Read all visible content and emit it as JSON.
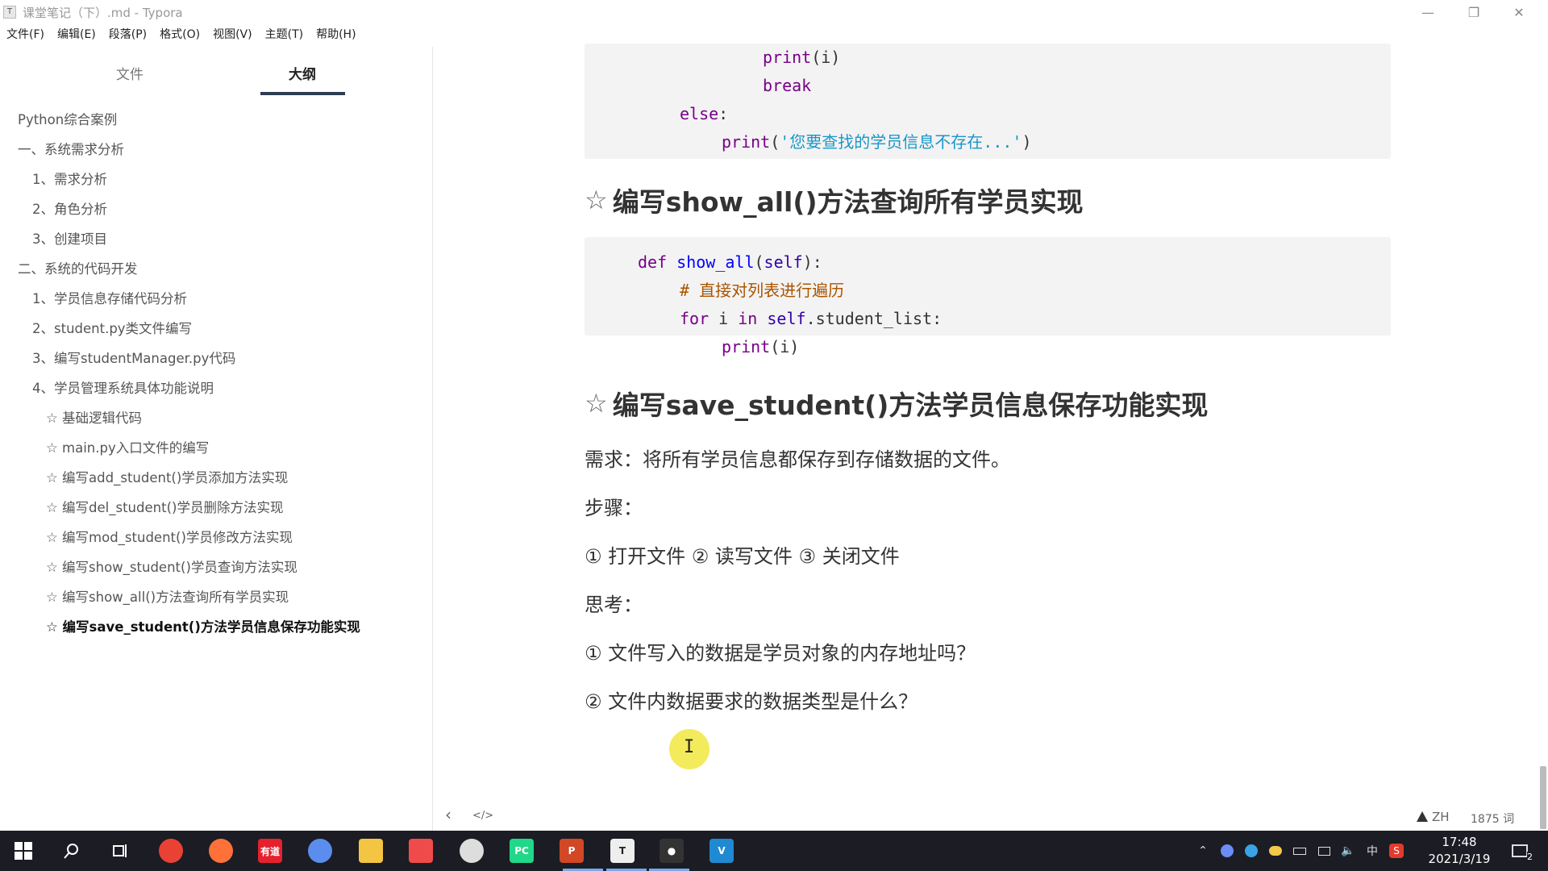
{
  "window": {
    "title": "课堂笔记（下）.md - Typora",
    "app_icon": "T"
  },
  "menu": [
    "文件(F)",
    "编辑(E)",
    "段落(P)",
    "格式(O)",
    "视图(V)",
    "主题(T)",
    "帮助(H)"
  ],
  "sidebar": {
    "tabs": [
      "文件",
      "大纲"
    ],
    "active_tab": "大纲",
    "outline": [
      {
        "text": "Python综合案例",
        "level": 1
      },
      {
        "text": "一、系统需求分析",
        "level": 1
      },
      {
        "text": "1、需求分析",
        "level": 2
      },
      {
        "text": "2、角色分析",
        "level": 2
      },
      {
        "text": "3、创建项目",
        "level": 2
      },
      {
        "text": "二、系统的代码开发",
        "level": 1
      },
      {
        "text": "1、学员信息存储代码分析",
        "level": 2
      },
      {
        "text": "2、student.py类文件编写",
        "level": 2
      },
      {
        "text": "3、编写studentManager.py代码",
        "level": 2
      },
      {
        "text": "4、学员管理系统具体功能说明",
        "level": 2
      },
      {
        "text": "☆ 基础逻辑代码",
        "level": 3
      },
      {
        "text": "☆ main.py入口文件的编写",
        "level": 3
      },
      {
        "text": "☆ 编写add_student()学员添加方法实现",
        "level": 3
      },
      {
        "text": "☆ 编写del_student()学员删除方法实现",
        "level": 3
      },
      {
        "text": "☆ 编写mod_student()学员修改方法实现",
        "level": 3
      },
      {
        "text": "☆ 编写show_student()学员查询方法实现",
        "level": 3
      },
      {
        "text": "☆ 编写show_all()方法查询所有学员实现",
        "level": 3
      },
      {
        "text": "☆ 编写save_student()方法学员信息保存功能实现",
        "level": 3,
        "active": true
      }
    ]
  },
  "editor": {
    "code_block_1": [
      [
        {
          "t": "print",
          "c": "kw"
        },
        {
          "t": "(i)",
          "c": "pl"
        }
      ],
      [
        {
          "t": "break",
          "c": "kw"
        }
      ],
      [
        {
          "t": "else",
          "c": "kw"
        },
        {
          "t": ":",
          "c": "pl"
        }
      ],
      [
        {
          "t": "print",
          "c": "kw"
        },
        {
          "t": "(",
          "c": "pl"
        },
        {
          "t": "'您要查找的学员信息不存在...'",
          "c": "str"
        },
        {
          "t": ")",
          "c": "pl"
        }
      ]
    ],
    "heading_1": {
      "star": "☆",
      "text": "编写show_all()方法查询所有学员实现"
    },
    "code_block_2": [
      [
        {
          "t": "def ",
          "c": "kw"
        },
        {
          "t": "show_all",
          "c": "fn"
        },
        {
          "t": "(",
          "c": "pl"
        },
        {
          "t": "self",
          "c": "self"
        },
        {
          "t": "):",
          "c": "pl"
        }
      ],
      [
        {
          "t": "# 直接对列表进行遍历",
          "c": "cm"
        }
      ],
      [
        {
          "t": "for ",
          "c": "kw"
        },
        {
          "t": "i ",
          "c": "pl"
        },
        {
          "t": "in ",
          "c": "kw"
        },
        {
          "t": "self",
          "c": "self"
        },
        {
          "t": ".student_list:",
          "c": "pl"
        }
      ],
      [
        {
          "t": "print",
          "c": "kw"
        },
        {
          "t": "(i)",
          "c": "pl"
        }
      ]
    ],
    "heading_2": {
      "star": "☆",
      "text": "编写save_student()方法学员信息保存功能实现"
    },
    "paragraphs": [
      "需求：将所有学员信息都保存到存储数据的文件。",
      "步骤：",
      "① 打开文件 ② 读写文件 ③ 关闭文件",
      "思考：",
      "① 文件写入的数据是学员对象的内存地址吗？",
      "② 文件内数据要求的数据类型是什么？"
    ]
  },
  "footer": {
    "back_icon": "‹",
    "source_icon": "</>",
    "lang": "ZH",
    "word_count": "1875 词"
  },
  "cursor": {
    "glyph": "I"
  },
  "taskbar": {
    "apps": [
      {
        "name": "chrome-icon",
        "color": "#e94235",
        "label": ""
      },
      {
        "name": "firefox-icon",
        "color": "#ff7139",
        "label": ""
      },
      {
        "name": "youdao-icon",
        "color": "#e5212d",
        "label": "有道"
      },
      {
        "name": "browser-icon",
        "color": "#5b8def",
        "label": ""
      },
      {
        "name": "file-explorer-icon",
        "color": "#f4c542",
        "label": ""
      },
      {
        "name": "video-app-icon",
        "color": "#f04b4b",
        "label": ""
      },
      {
        "name": "chrome-beta-icon",
        "color": "#dddddd",
        "label": ""
      },
      {
        "name": "pycharm-icon",
        "color": "#21d789",
        "label": "PC"
      },
      {
        "name": "powerpoint-icon",
        "color": "#d24726",
        "label": "P"
      },
      {
        "name": "typora-icon",
        "color": "#eeeeee",
        "label": "T"
      },
      {
        "name": "recorder-icon",
        "color": "#333333",
        "label": "●"
      },
      {
        "name": "vscode-icon",
        "color": "#1f8ad2",
        "label": "V"
      }
    ],
    "tray": {
      "ime": "中",
      "clock_time": "17:48",
      "clock_date": "2021/3/19",
      "notification_count": "2"
    }
  }
}
